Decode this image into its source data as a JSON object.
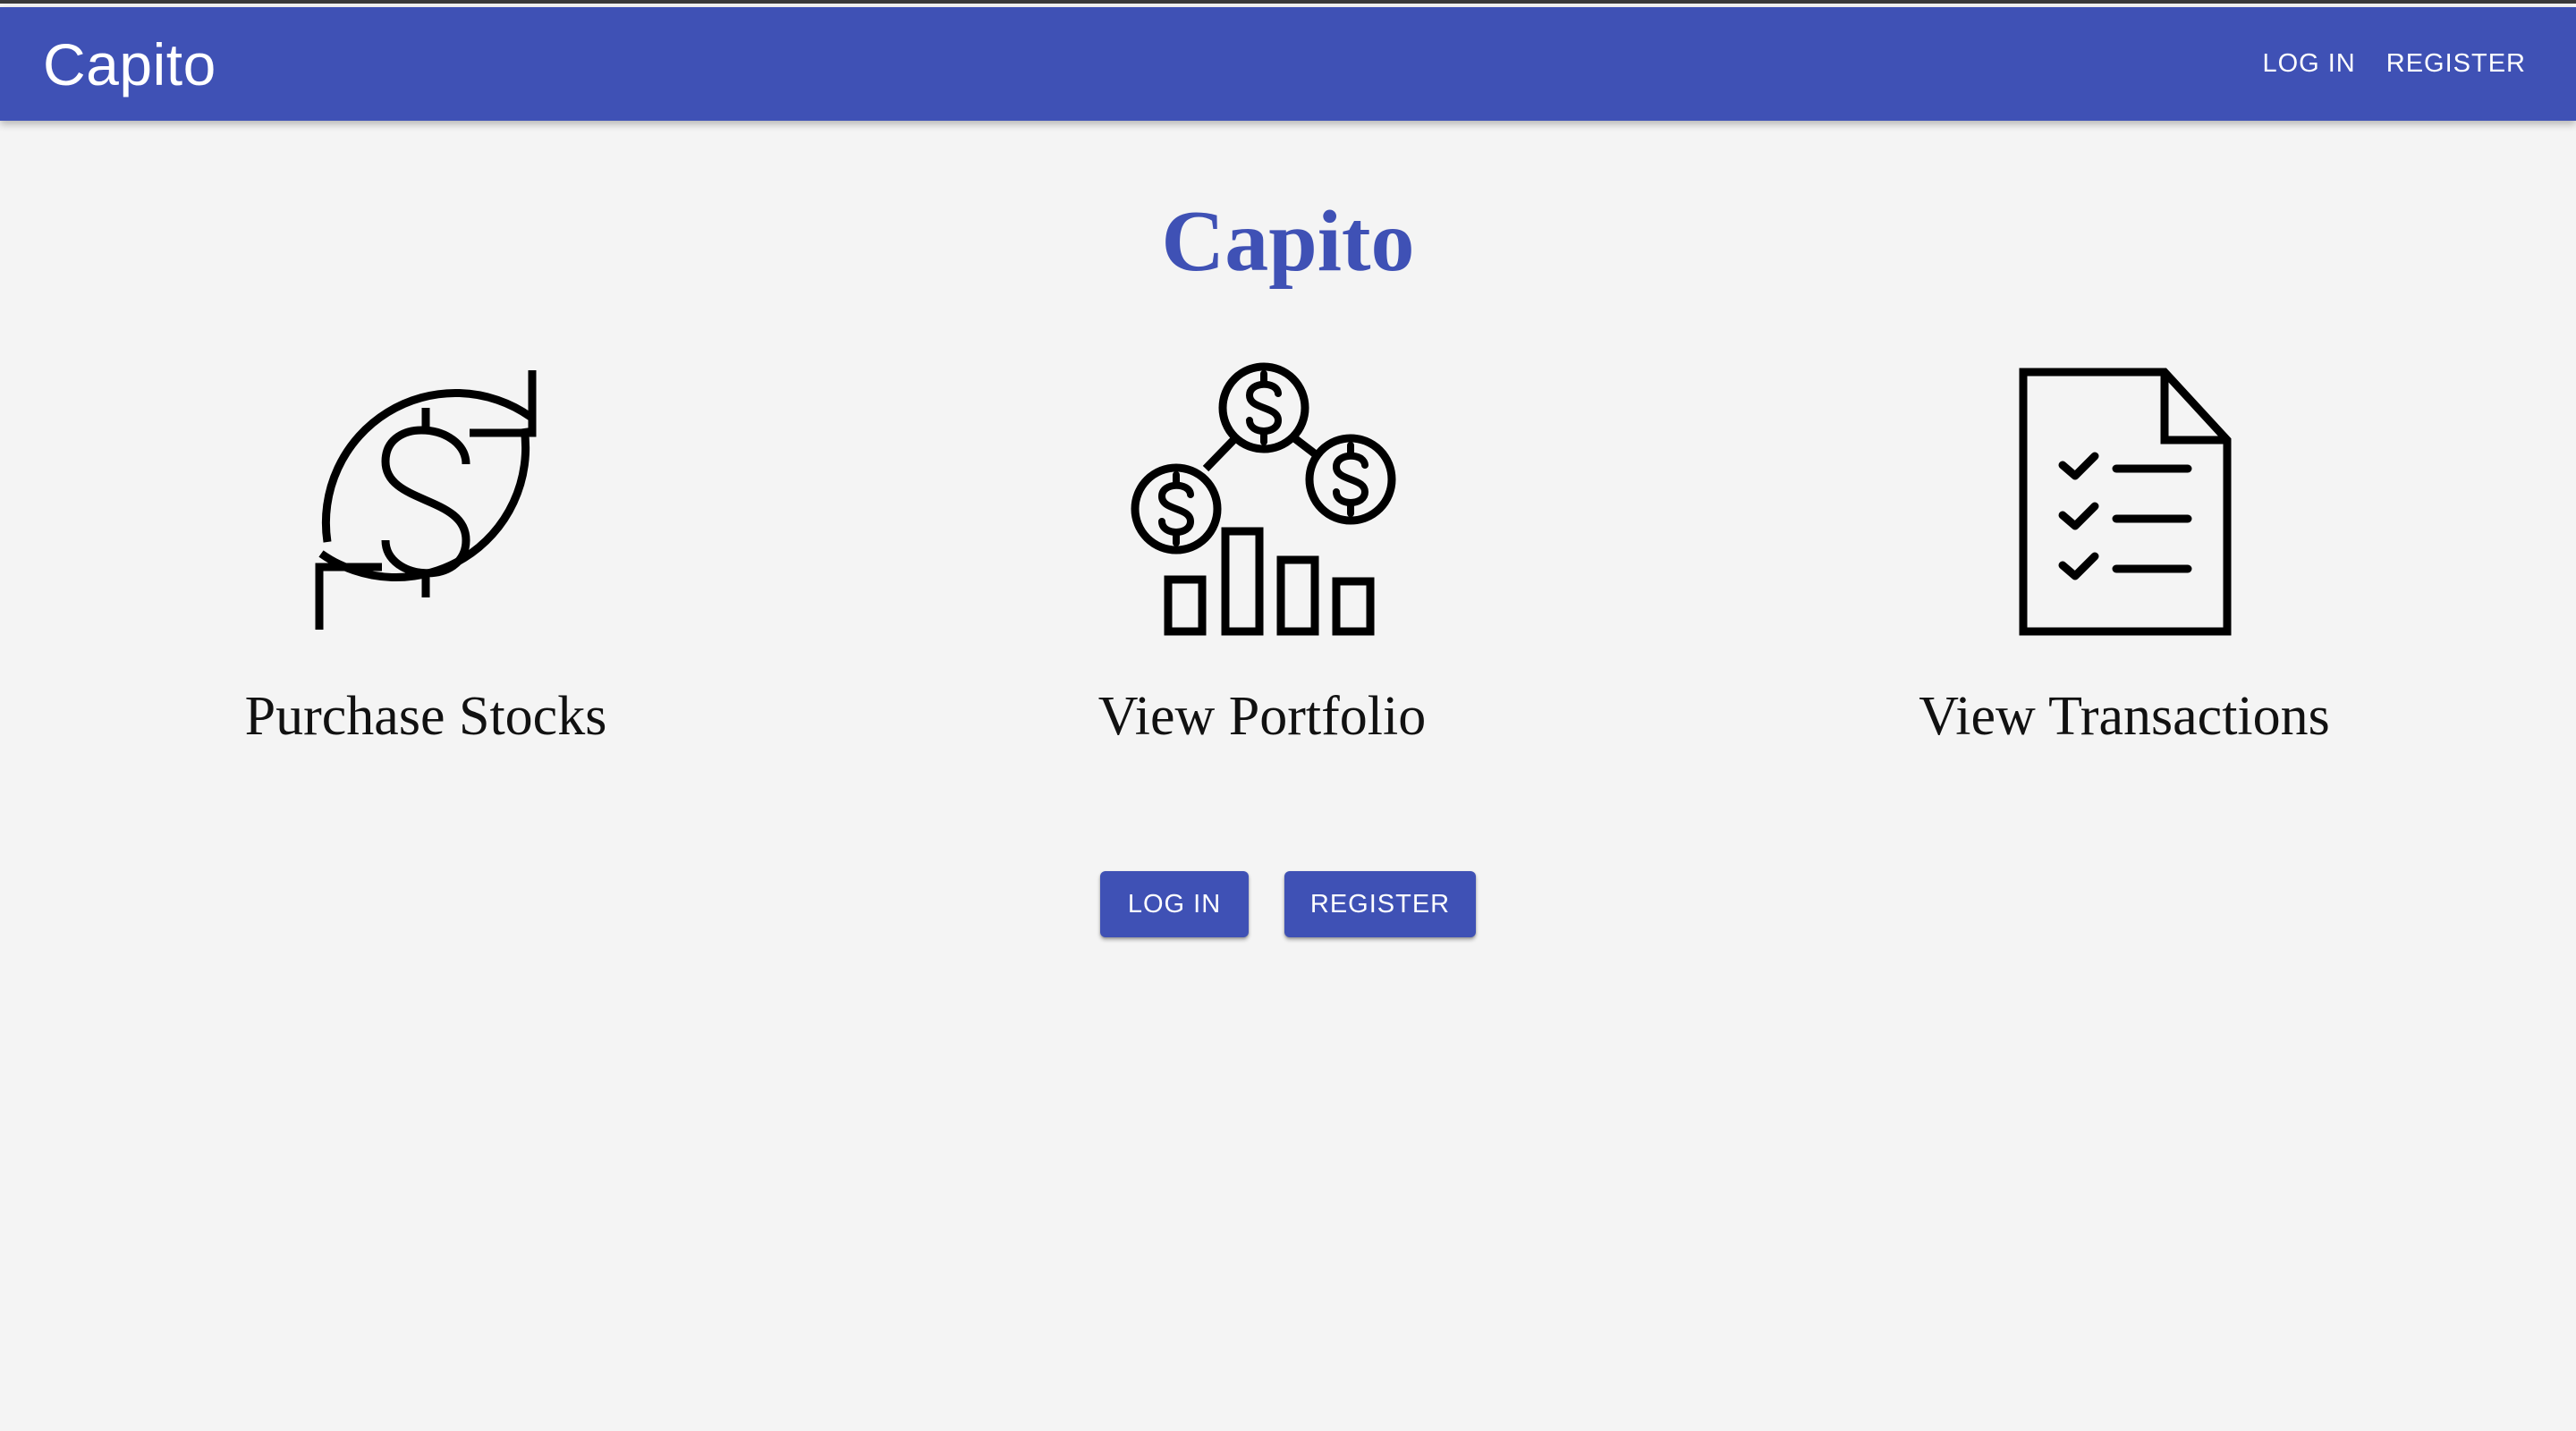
{
  "appbar": {
    "brand": "Capito",
    "nav": {
      "login_label": "LOG IN",
      "register_label": "REGISTER"
    }
  },
  "hero": {
    "title": "Capito"
  },
  "features": [
    {
      "label": "Purchase Stocks",
      "icon": "dollar-exchange-icon"
    },
    {
      "label": "View Portfolio",
      "icon": "portfolio-chart-icon"
    },
    {
      "label": "View Transactions",
      "icon": "checklist-document-icon"
    }
  ],
  "actions": {
    "login_label": "LOG IN",
    "register_label": "REGISTER"
  },
  "colors": {
    "primary": "#3f51b5",
    "background": "#f4f4f4",
    "text": "#111111"
  }
}
